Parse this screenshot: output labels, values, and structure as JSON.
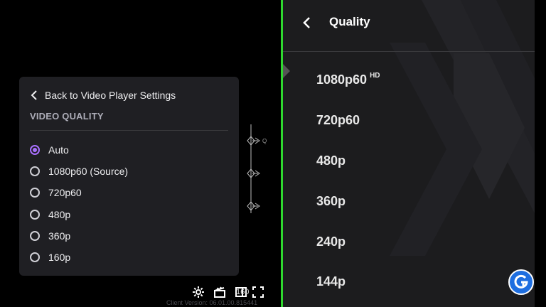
{
  "left_menu": {
    "back_label": "Back to Video Player Settings",
    "section_title": "VIDEO QUALITY",
    "options": [
      {
        "label": "Auto",
        "selected": true
      },
      {
        "label": "1080p60 (Source)",
        "selected": false
      },
      {
        "label": "720p60",
        "selected": false
      },
      {
        "label": "480p",
        "selected": false
      },
      {
        "label": "360p",
        "selected": false
      },
      {
        "label": "160p",
        "selected": false
      }
    ],
    "accent_color": "#a970ff"
  },
  "player_controls": {
    "badge_text": "160",
    "client_version": "Client Version: 06.01.00.815441"
  },
  "right_menu": {
    "title": "Quality",
    "items": [
      {
        "label": "1080p60",
        "badge": "HD"
      },
      {
        "label": "720p60",
        "badge": ""
      },
      {
        "label": "480p",
        "badge": ""
      },
      {
        "label": "360p",
        "badge": ""
      },
      {
        "label": "240p",
        "badge": ""
      },
      {
        "label": "144p",
        "badge": ""
      }
    ]
  },
  "colors": {
    "divider": "#2fd82f",
    "panel_bg": "#1f1f23",
    "right_bg": "#1c1c1e"
  },
  "icons": {
    "logo": "gamer-tweak-logo-icon"
  }
}
